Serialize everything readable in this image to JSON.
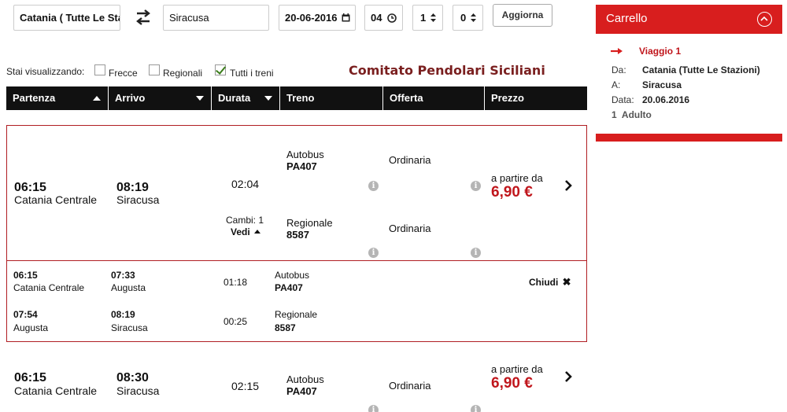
{
  "search": {
    "from": "Catania ( Tutte Le Sta",
    "to": "Siracusa",
    "date": "20-06-2016",
    "hour": "04",
    "adults": "1",
    "children": "0",
    "update_label": "Aggiorna"
  },
  "filters": {
    "label": "Stai visualizzando:",
    "frecce": "Frecce",
    "regionali": "Regionali",
    "tutti": "Tutti i treni"
  },
  "brand": "Comitato Pendolari Siciliani",
  "columns": {
    "partenza": "Partenza",
    "arrivo": "Arrivo",
    "durata": "Durata",
    "treno": "Treno",
    "offerta": "Offerta",
    "prezzo": "Prezzo"
  },
  "results": [
    {
      "dep_time": "06:15",
      "dep_station": "Catania Centrale",
      "arr_time": "08:19",
      "arr_station": "Siracusa",
      "duration": "02:04",
      "changes": "Cambi: 1",
      "see": "Vedi",
      "trains": [
        {
          "type": "Autobus",
          "code": "PA407",
          "offer": "Ordinaria"
        },
        {
          "type": "Regionale",
          "code": "8587",
          "offer": "Ordinaria"
        }
      ],
      "price_from": "a partire da",
      "price": "6,90 €",
      "legs": [
        {
          "dep_time": "06:15",
          "dep_station": "Catania Centrale",
          "arr_time": "07:33",
          "arr_station": "Augusta",
          "duration": "01:18",
          "type": "Autobus",
          "code": "PA407"
        },
        {
          "dep_time": "07:54",
          "dep_station": "Augusta",
          "arr_time": "08:19",
          "arr_station": "Siracusa",
          "duration": "00:25",
          "type": "Regionale",
          "code": "8587"
        }
      ],
      "close_label": "Chiudi"
    },
    {
      "dep_time": "06:15",
      "dep_station": "Catania Centrale",
      "arr_time": "08:30",
      "arr_station": "Siracusa",
      "duration": "02:15",
      "trains": [
        {
          "type": "Autobus",
          "code": "PA407",
          "offer": "Ordinaria"
        }
      ],
      "price_from": "a partire da",
      "price": "6,90 €"
    }
  ],
  "cart": {
    "title": "Carrello",
    "trip": "Viaggio 1",
    "from_label": "Da:",
    "from_value": "Catania (Tutte Le Stazioni)",
    "to_label": "A:",
    "to_value": "Siracusa",
    "date_label": "Data:",
    "date_value": "20.06.2016",
    "passengers": "1  Adulto"
  },
  "colors": {
    "accent": "#d81e1e",
    "price": "#c0161c",
    "header_bg": "#111111",
    "brand": "#7a1f1f"
  }
}
